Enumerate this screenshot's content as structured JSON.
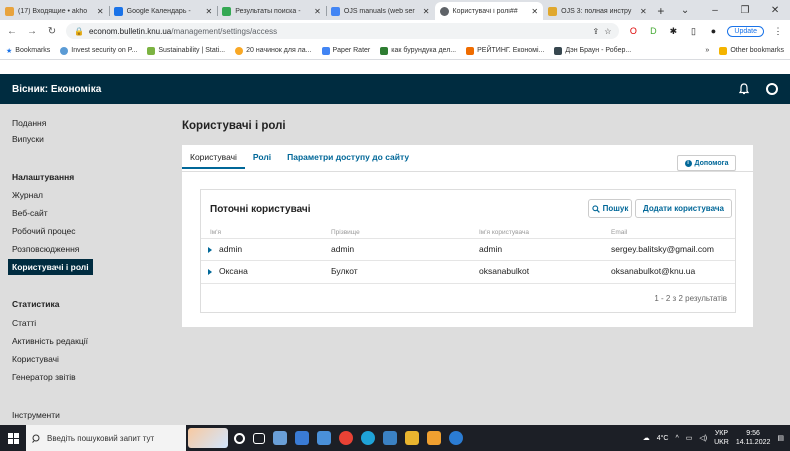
{
  "browser": {
    "tabs": [
      {
        "title": "(17) Входящие • akho",
        "color": "#e8a33d"
      },
      {
        "title": "Google Календарь - ",
        "color": "#1a73e8"
      },
      {
        "title": "Результаты поиска - ",
        "color": "#34a853"
      },
      {
        "title": "OJS manuals (web ser",
        "color": "#4285f4"
      },
      {
        "title": "Користувачі і ролі##",
        "color": "#5f6368",
        "active": true
      },
      {
        "title": "OJS 3: полная инстру",
        "color": "#e0a82e"
      }
    ],
    "url_host": "econom.bulletin.knu.ua",
    "url_path": "/management/settings/access",
    "update_label": "Update",
    "bookmarks": [
      {
        "label": "Bookmarks",
        "color": ""
      },
      {
        "label": "Invest security on P...",
        "color": "#5b9bd5"
      },
      {
        "label": "Sustainability | Stati...",
        "color": "#7cb342"
      },
      {
        "label": "20 начинок для ла...",
        "color": "#f9a825"
      },
      {
        "label": "Paper Rater",
        "color": "#4285f4"
      },
      {
        "label": "как бурундука дел...",
        "color": "#2e7d32"
      },
      {
        "label": "РЕЙТИНГ. Економі...",
        "color": "#ef6c00"
      },
      {
        "label": "Дэн Браун - Робер...",
        "color": "#37474f"
      }
    ],
    "bookmarks_more": "»",
    "other_bookmarks": "Other bookmarks"
  },
  "app": {
    "site_title": "Вісник: Економіка"
  },
  "nav": {
    "submissions": "Подання",
    "issues": "Випуски",
    "settings_heading": "Налаштування",
    "journal": "Журнал",
    "website": "Веб-сайт",
    "workflow": "Робочий процес",
    "distribution": "Розповсюдження",
    "users_roles": "Користувачі і ролі",
    "statistics_heading": "Статистика",
    "articles": "Статті",
    "editorial_activity": "Активність редакції",
    "users": "Користувачі",
    "report_generator": "Генератор звітів",
    "tools": "Інструменти"
  },
  "page": {
    "title": "Користувачі і ролі",
    "tabs": [
      "Користувачі",
      "Ролі",
      "Параметри доступу до сайту"
    ],
    "help": "Допомога"
  },
  "grid": {
    "title": "Поточні користувачі",
    "search": "Пошук",
    "add_user": "Додати користувача",
    "columns": [
      "Ім'я",
      "Прізвище",
      "Ім'я користувача",
      "Email"
    ],
    "rows": [
      [
        "admin",
        "admin",
        "admin",
        "sergey.balitsky@gmail.com"
      ],
      [
        "Оксана",
        "Булкот",
        "oksanabulkot",
        "oksanabulkot@knu.ua"
      ]
    ],
    "pager": "1 - 2 з 2 результатів"
  },
  "taskbar": {
    "search_placeholder": "Введіть пошуковий запит тут",
    "weather": "4°C",
    "lang_line1": "УКР",
    "lang_line2": "UKR",
    "time": "9:56",
    "date": "14.11.2022"
  }
}
